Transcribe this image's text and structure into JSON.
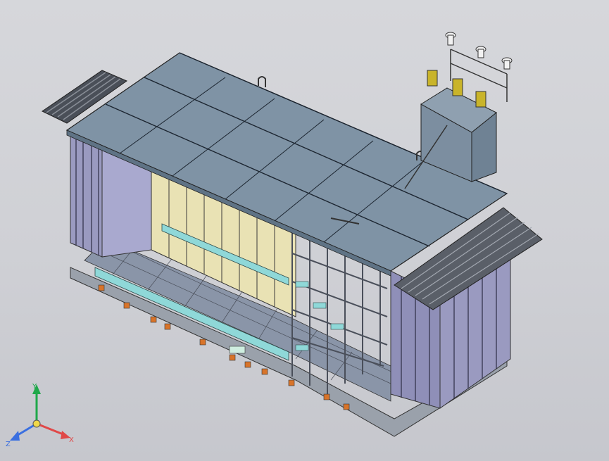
{
  "viewport": {
    "background_top": "#d6d7db",
    "background_bottom": "#c6c7cd",
    "model": "substation-enclosure-assembly"
  },
  "colors": {
    "panel_blue": "#7f93a5",
    "panel_blue_dark": "#5f7385",
    "wall_purple": "#8f8fb8",
    "wall_purple_light": "#a9a9cf",
    "interior_cream": "#e9e2b4",
    "frame_grey": "#9aa1ab",
    "rail_cyan": "#8fd8d8",
    "tank_blue": "#6f8294",
    "insulator_yellow": "#c9b42a",
    "bracket_orange": "#d8742a"
  },
  "axis_triad": {
    "y_label": "Y",
    "x_label": "X",
    "z_label": "Z",
    "y_color": "#1fa84a",
    "x_color": "#e04848",
    "z_color": "#3a6fe0"
  }
}
